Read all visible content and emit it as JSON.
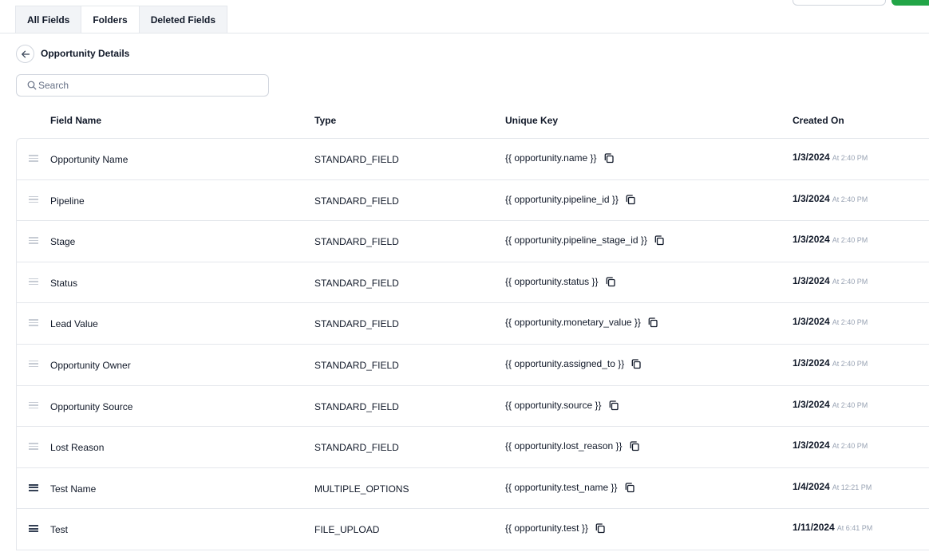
{
  "tabs": [
    {
      "label": "All Fields"
    },
    {
      "label": "Folders"
    },
    {
      "label": "Deleted Fields"
    }
  ],
  "folder": {
    "title": "Opportunity Details"
  },
  "search": {
    "placeholder": "Search",
    "value": ""
  },
  "columns": {
    "name": "Field Name",
    "type": "Type",
    "key": "Unique Key",
    "created": "Created On"
  },
  "rows": [
    {
      "name": "Opportunity Name",
      "type": "STANDARD_FIELD",
      "key": "{{ opportunity.name }}",
      "date": "1/3/2024",
      "time": "At 2:40 PM"
    },
    {
      "name": "Pipeline",
      "type": "STANDARD_FIELD",
      "key": "{{ opportunity.pipeline_id }}",
      "date": "1/3/2024",
      "time": "At 2:40 PM"
    },
    {
      "name": "Stage",
      "type": "STANDARD_FIELD",
      "key": "{{ opportunity.pipeline_stage_id }}",
      "date": "1/3/2024",
      "time": "At 2:40 PM"
    },
    {
      "name": "Status",
      "type": "STANDARD_FIELD",
      "key": "{{ opportunity.status }}",
      "date": "1/3/2024",
      "time": "At 2:40 PM"
    },
    {
      "name": "Lead Value",
      "type": "STANDARD_FIELD",
      "key": "{{ opportunity.monetary_value }}",
      "date": "1/3/2024",
      "time": "At 2:40 PM"
    },
    {
      "name": "Opportunity Owner",
      "type": "STANDARD_FIELD",
      "key": "{{ opportunity.assigned_to }}",
      "date": "1/3/2024",
      "time": "At 2:40 PM"
    },
    {
      "name": "Opportunity Source",
      "type": "STANDARD_FIELD",
      "key": "{{ opportunity.source }}",
      "date": "1/3/2024",
      "time": "At 2:40 PM"
    },
    {
      "name": "Lost Reason",
      "type": "STANDARD_FIELD",
      "key": "{{ opportunity.lost_reason }}",
      "date": "1/3/2024",
      "time": "At 2:40 PM"
    },
    {
      "name": "Test Name",
      "type": "MULTIPLE_OPTIONS",
      "key": "{{ opportunity.test_name }}",
      "date": "1/4/2024",
      "time": "At 12:21 PM"
    },
    {
      "name": "Test",
      "type": "FILE_UPLOAD",
      "key": "{{ opportunity.test }}",
      "date": "1/11/2024",
      "time": "At 6:41 PM"
    }
  ],
  "colors": {
    "accent": "#22a547",
    "border": "#e4e7ec",
    "muted": "#98a2b3"
  }
}
